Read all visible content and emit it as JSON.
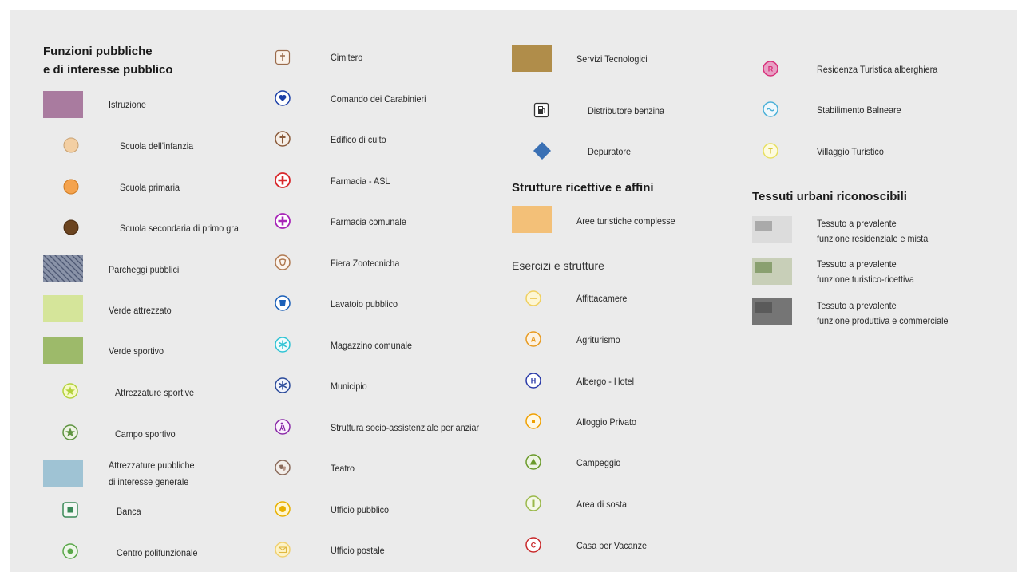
{
  "legend": {
    "col1": {
      "title_line1": "Funzioni pubbliche",
      "title_line2": "e di interesse pubblico",
      "items": [
        {
          "label": "Istruzione",
          "color": "#a97b9f",
          "icon": "istruzione-swatch"
        },
        {
          "label": "Scuola dell'infanzia",
          "color": "#f3cfa3",
          "icon": "scuola-infanzia-icon"
        },
        {
          "label": "Scuola primaria",
          "color": "#f4a34e",
          "icon": "scuola-primaria-icon"
        },
        {
          "label": "Scuola secondaria di primo gra",
          "color": "#6b4420",
          "icon": "scuola-secondaria-icon"
        },
        {
          "label": "Parcheggi pubblici",
          "color": "#5a6478",
          "icon": "parcheggi-swatch"
        },
        {
          "label": "Verde attrezzato",
          "color": "#d5e59a",
          "icon": "verde-attrezzato-swatch"
        },
        {
          "label": "Verde sportivo",
          "color": "#9dba6a",
          "icon": "verde-sportivo-swatch"
        },
        {
          "label": "Attrezzature sportive",
          "color": "#b3d23a",
          "icon": "star-icon"
        },
        {
          "label": "Campo sportivo",
          "color": "#5e9440",
          "icon": "star-icon"
        },
        {
          "label_line1": "Attrezzature pubbliche",
          "label_line2": "di interesse generale",
          "color": "#9fc3d4",
          "icon": "attrezzature-pubbliche-swatch"
        },
        {
          "label": "Banca",
          "color": "#3a8a58",
          "icon": "banca-icon"
        },
        {
          "label": "Centro polifunzionale",
          "color": "#5aa84a",
          "icon": "centro-polifunzionale-icon"
        }
      ]
    },
    "col2": {
      "items": [
        {
          "label": "Cimitero",
          "color": "#9a6a4a",
          "icon": "cimitero-icon"
        },
        {
          "label": "Comando dei Carabinieri",
          "color": "#1b3fa8",
          "icon": "carabinieri-icon"
        },
        {
          "label": "Edifico di culto",
          "color": "#8a5a3a",
          "icon": "cross-icon"
        },
        {
          "label": "Farmacia - ASL",
          "color": "#d8262a",
          "icon": "farmacia-icon"
        },
        {
          "label": "Farmacia comunale",
          "color": "#a826b8",
          "icon": "farmacia-icon"
        },
        {
          "label": "Fiera Zootecnicha",
          "color": "#b07a52",
          "icon": "fiera-icon"
        },
        {
          "label": "Lavatoio pubblico",
          "color": "#1a5fb8",
          "icon": "lavatoio-icon"
        },
        {
          "label": "Magazzino comunale",
          "color": "#2ec3d4",
          "icon": "asterisk-icon"
        },
        {
          "label": "Municipio",
          "color": "#2a4a9a",
          "icon": "asterisk-icon"
        },
        {
          "label": "Struttura socio-assistenziale per anziar",
          "color": "#8a2aa8",
          "icon": "anziani-icon"
        },
        {
          "label": "Teatro",
          "color": "#8a6a5a",
          "icon": "teatro-icon"
        },
        {
          "label": "Ufficio pubblico",
          "color": "#e8b000",
          "icon": "ufficio-pubblico-icon"
        },
        {
          "label": "Ufficio postale",
          "color": "#f0d070",
          "icon": "envelope-icon"
        }
      ]
    },
    "col3": {
      "items_top": [
        {
          "label": "Servizi Tecnologici",
          "color": "#b08d4a",
          "icon": "servizi-tecnologici-swatch"
        },
        {
          "label": "Distributore benzina",
          "color": "#333333",
          "icon": "fuel-pump-icon"
        },
        {
          "label": "Depuratore",
          "color": "#3a70b4",
          "icon": "diamond-icon"
        }
      ],
      "title": "Strutture ricettive e affini",
      "area_item": {
        "label": "Aree turistiche complesse",
        "color": "#f3c078"
      },
      "subtitle": "Esercizi e strutture",
      "items": [
        {
          "label": "Affittacamere",
          "color": "#f0d060",
          "icon": "affittacamere-icon",
          "glyph": ""
        },
        {
          "label": "Agriturismo",
          "color": "#e89a20",
          "icon": "letter-a-icon",
          "glyph": "A"
        },
        {
          "label": "Albergo - Hotel",
          "color": "#2a3aa8",
          "icon": "letter-h-icon",
          "glyph": "H"
        },
        {
          "label": "Alloggio Privato",
          "color": "#f0a000",
          "icon": "square-dot-icon",
          "glyph": ""
        },
        {
          "label": "Campeggio",
          "color": "#6a9a2a",
          "icon": "triangle-icon",
          "glyph": ""
        },
        {
          "label": "Area di sosta",
          "color": "#9ab84a",
          "icon": "bar-icon",
          "glyph": ""
        },
        {
          "label": "Casa per Vacanze",
          "color": "#c8282a",
          "icon": "letter-c-icon",
          "glyph": "C"
        }
      ]
    },
    "col4": {
      "items_top": [
        {
          "label": "Residenza Turistica alberghiera",
          "color": "#d8307a",
          "icon": "letter-r-icon",
          "glyph": "R"
        },
        {
          "label": "Stabilimento Balneare",
          "color": "#4ab0d8",
          "icon": "wave-icon",
          "glyph": "~"
        },
        {
          "label": "Villaggio Turistico",
          "color": "#e8e060",
          "icon": "letter-t-icon",
          "glyph": "T"
        }
      ],
      "title": "Tessuti urbani riconoscibili",
      "tessuti": [
        {
          "line1": "Tessuto a prevalente",
          "line2": "funzione residenziale e mista",
          "bg": "#dcdcdc",
          "inner": "#aaaaaa"
        },
        {
          "line1": "Tessuto a prevalente",
          "line2": "funzione turistico-ricettiva",
          "bg": "#c8cfb8",
          "inner": "#8aa070"
        },
        {
          "line1": "Tessuto a prevalente",
          "line2": "funzione produttiva e commerciale",
          "bg": "#757575",
          "inner": "#5a5a5a"
        }
      ]
    }
  }
}
